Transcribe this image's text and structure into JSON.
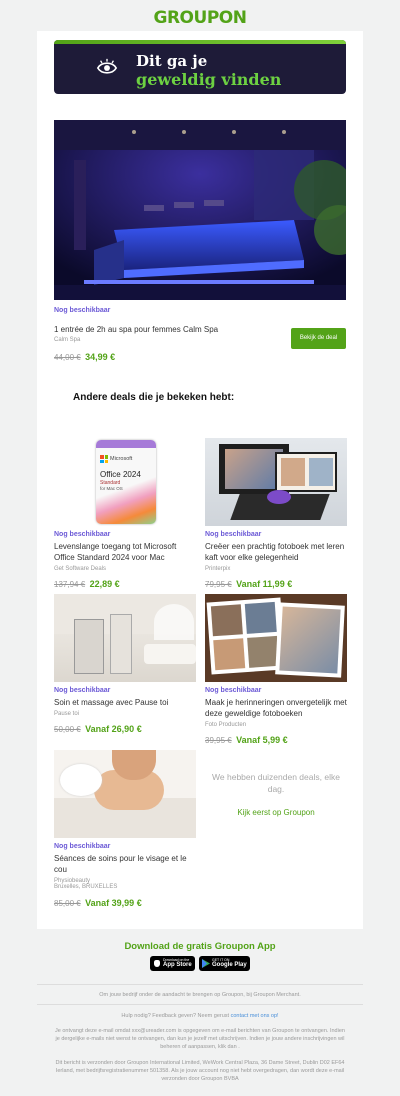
{
  "header": {
    "logo": "GROUPON"
  },
  "banner": {
    "line1": "Dit ga je",
    "line2": "geweldig vinden"
  },
  "featured": {
    "availability": "Nog beschikbaar",
    "title": "1 entrée de 2h au spa pour femmes Calm Spa",
    "merchant": "Calm Spa",
    "old_price": "44,00 €",
    "new_price": "34,99 €",
    "button": "Bekijk de deal"
  },
  "section_title": "Andere deals die je bekeken hebt:",
  "deals": [
    {
      "availability": "Nog beschikbaar",
      "title": "Levenslange toegang tot Microsoft Office Standard 2024 voor Mac",
      "merchant": "Get Software Deals",
      "old_price": "137,94 €",
      "new_price": "22,89 €",
      "box_brand": "Microsoft",
      "box_title": "Office 2024",
      "box_sub": "Standard",
      "box_sub2": "for Mac OS"
    },
    {
      "availability": "Nog beschikbaar",
      "title": "Creëer een prachtig fotoboek met leren kaft voor elke gelegenheid",
      "merchant": "Printerpix",
      "old_price": "79,95 €",
      "new_price": "Vanaf 11,99 €"
    },
    {
      "availability": "Nog beschikbaar",
      "title": "Soin et massage avec Pause toi",
      "merchant": "Pause toi",
      "old_price": "50,00 €",
      "new_price": "Vanaf 26,90 €"
    },
    {
      "availability": "Nog beschikbaar",
      "title": "Maak je herinneringen onvergetelijk met deze geweldige fotoboeken",
      "merchant": "Foto Producten",
      "old_price": "39,95 €",
      "new_price": "Vanaf 5,99 €"
    },
    {
      "availability": "Nog beschikbaar",
      "title": "Séances de soins pour le visage et le cou",
      "merchant": "Physiobeauty",
      "merchant2": "Bruxelles, BRUXELLES",
      "old_price": "85,00 €",
      "new_price": "Vanaf 39,99 €"
    }
  ],
  "more": {
    "text": "We hebben duizenden deals, elke dag.",
    "link": "Kijk eerst op Groupon"
  },
  "app": {
    "title": "Download de gratis Groupon App",
    "appstore_small": "Download on the",
    "appstore_big": "App Store",
    "play_small": "GET IT ON",
    "play_big": "Google Play"
  },
  "footer": {
    "merchant_line": "Om jouw bedrijf onder de aandacht te brengen op Groupon, bij Groupon Merchant.",
    "help_prefix": "Hulp nodig? Feedback geven? Neem gerust",
    "help_link": "contact met ons op!",
    "reason": "Je ontvangt deze e-mail omdat xxx@ureader.com is opgegeven om e-mail berichten van Groupon te ontvangen. Indien je dergelijke e-mails niet wenst te ontvangen, dan kun je jezelf met uitschrijven. Indien je jouw andere inschrijvingen wil beheren of aanpassen, klik dan .",
    "legal": "Dit bericht is verzonden door Groupon International Limited, WeWork Central Plaza, 36 Dame Street, Dublin D02 EF64 Ierland, met bedrijfsregistratienummer 501358. Als je jouw account nog niet hebt overgedragen, dan wordt deze e-mail verzonden door Groupon BVBA"
  },
  "colors": {
    "brand_green": "#53a318",
    "availability_purple": "#6c5ad6",
    "banner_bg": "#1e1b38",
    "page_bg": "#f1f2f2"
  }
}
